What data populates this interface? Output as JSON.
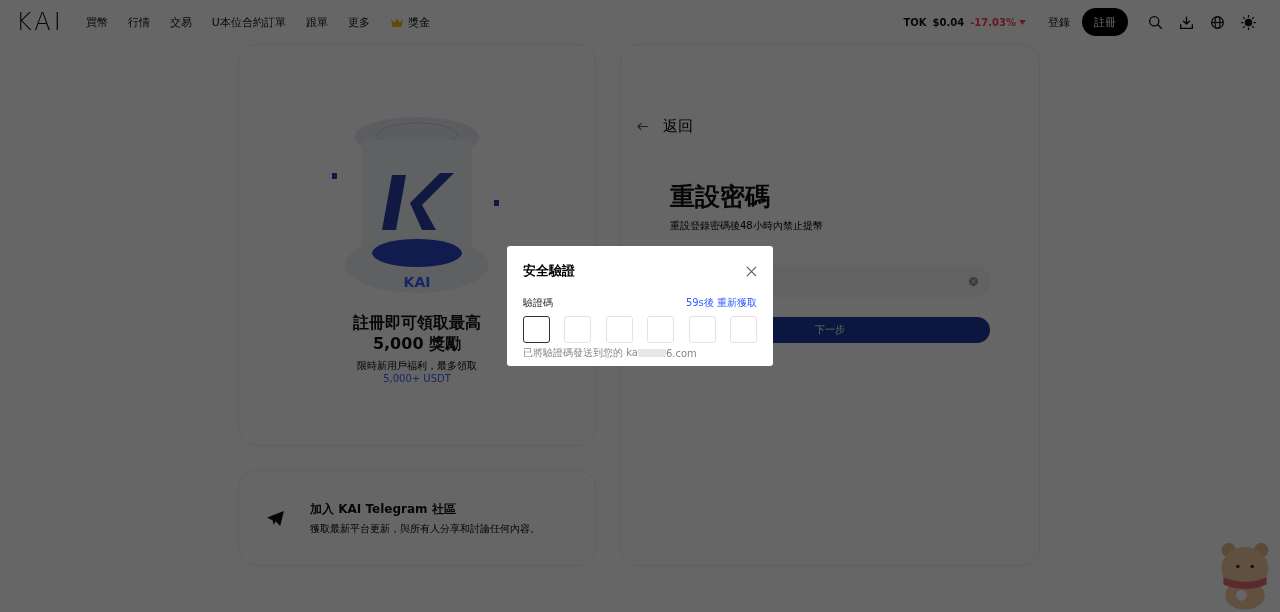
{
  "header": {
    "logo": "KAI",
    "nav": [
      {
        "label": "買幣",
        "kind": "plain"
      },
      {
        "label": "行情",
        "kind": "plain"
      },
      {
        "label": "交易",
        "kind": "plain"
      },
      {
        "label": "U本位合約訂單",
        "kind": "plain"
      },
      {
        "label": "跟單",
        "kind": "plain"
      },
      {
        "label": "更多",
        "kind": "plain"
      },
      {
        "label": "獎金",
        "kind": "reward"
      }
    ],
    "ticker": {
      "symbol": "TOK",
      "price": "$0.04",
      "change": "-17.03%"
    },
    "login": "登錄",
    "register": "註冊"
  },
  "promo": {
    "logo": "KAI",
    "headline": "註冊即可領取最高 5,000 獎勵",
    "subtitle": "限時新用戶福利，最多領取 ",
    "subtitle_highlight": "5,000+ USDT"
  },
  "community": {
    "title": "加入 KAI Telegram 社區",
    "subtitle": "獲取最新平台更新，與所有人分享和討論任何內容。"
  },
  "form": {
    "back": "返回",
    "title": "重設密碼",
    "subtitle": "重設登錄密碼後48小時內禁止提幣",
    "next": "下一步"
  },
  "dialog": {
    "title": "安全驗證",
    "label": "驗證碼",
    "resend": "59s後 重新獲取",
    "code_boxes": [
      {
        "focused": true
      },
      {
        "focused": false
      },
      {
        "focused": false
      },
      {
        "focused": false
      },
      {
        "focused": false
      },
      {
        "focused": false
      }
    ],
    "hint_prefix": "已將驗證碼發送到您的 ka",
    "hint_suffix": "6.com"
  }
}
